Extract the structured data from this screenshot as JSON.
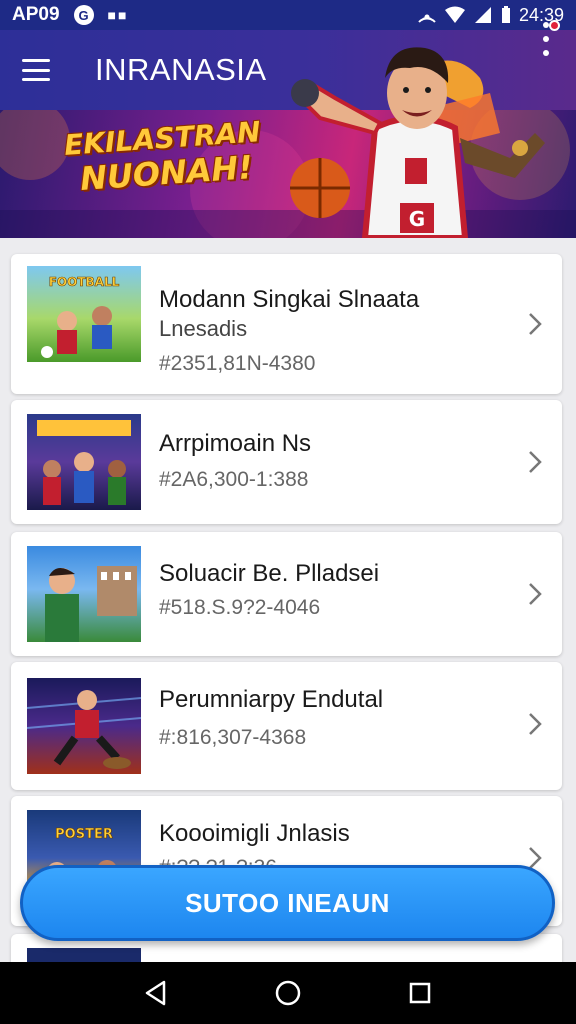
{
  "status_bar": {
    "time_left": "AP09",
    "time_right": "24:39"
  },
  "app_bar": {
    "title": "INRANASIA"
  },
  "banner": {
    "line1": "EKILASTRAN",
    "line2": "NUONAH!"
  },
  "list": {
    "items": [
      {
        "title": "Modann Singkai Slnaata",
        "subtitle": "Lnesadis",
        "code": "#2351,81N-4380",
        "thumb": "football"
      },
      {
        "title": "Arrpimoain Ns",
        "subtitle": "",
        "code": "#2A6,300-1:388",
        "thumb": "team"
      },
      {
        "title": "Soluacir Be. Plladsei",
        "subtitle": "",
        "code": "#518.S.9?2-4046",
        "thumb": "stadium"
      },
      {
        "title": "Perumniarpy Endutal",
        "subtitle": "",
        "code": "#:816,307-4368",
        "thumb": "action"
      },
      {
        "title": "Koooimigli Jnlasis",
        "subtitle": "",
        "code": "#:??.?1-?:36",
        "thumb": "poster"
      }
    ]
  },
  "fab": {
    "label": "SUTOO INEAUN"
  },
  "colors": {
    "app_bar": "#2d2f98",
    "fab": "#1d86ef",
    "notification": "#e0233c"
  }
}
